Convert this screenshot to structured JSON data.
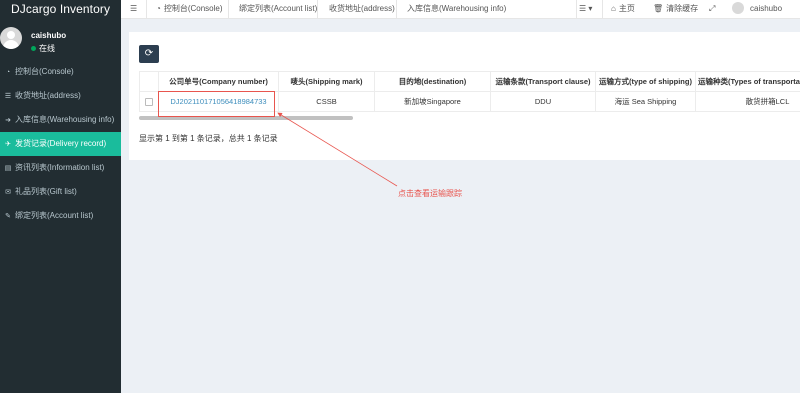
{
  "app": {
    "title": "DJcargo Inventory"
  },
  "user": {
    "name": "caishubo",
    "status": "在线"
  },
  "sidebar": {
    "items": [
      {
        "icon": "dashboard-icon",
        "label": "控制台(Console)",
        "active": false
      },
      {
        "icon": "list-icon",
        "label": "收货地址(address)",
        "active": false
      },
      {
        "icon": "login-icon",
        "label": "入库信息(Warehousing info)",
        "active": false
      },
      {
        "icon": "send-icon",
        "label": "发货记录(Delivery record)",
        "active": true
      },
      {
        "icon": "newspaper-icon",
        "label": "资讯列表(Information list)",
        "active": false
      },
      {
        "icon": "gift-icon",
        "label": "礼品列表(Gift list)",
        "active": false
      },
      {
        "icon": "edit-icon",
        "label": "绑定列表(Account list)",
        "active": false
      }
    ]
  },
  "header": {
    "tabs": [
      {
        "icon": "dashboard-icon",
        "label": "控制台(Console)"
      },
      {
        "label": "绑定列表(Account list)"
      },
      {
        "label": "收货地址(address)"
      },
      {
        "label": "入库信息(Warehousing info)"
      }
    ],
    "home_label": "主页",
    "clear_cache_label": "清除缓存",
    "user_name": "caishubo"
  },
  "table": {
    "columns": [
      "公司单号(Company number)",
      "唛头(Shipping mark)",
      "目的地(destination)",
      "运输条款(Transport clause)",
      "运输方式(type of shipping)",
      "运输种类(Types of transportation"
    ],
    "rows": [
      {
        "company_number": "DJ20211017105641898473​3",
        "shipping_mark": "CSSB",
        "destination": "新加坡Singapore",
        "transport_clause": "DDU",
        "type_of_shipping": "海运 Sea Shipping",
        "types_of_transportation": "散货拼箱LCL"
      }
    ],
    "page_info": "显示第 1 到第 1 条记录，总共 1 条记录"
  },
  "annotation": {
    "note": "点击查看运输跟踪",
    "color": "#e8554e"
  },
  "colors": {
    "sidebar_bg": "#222d32",
    "active_item": "#1abc9c",
    "link": "#3c8dbc"
  }
}
